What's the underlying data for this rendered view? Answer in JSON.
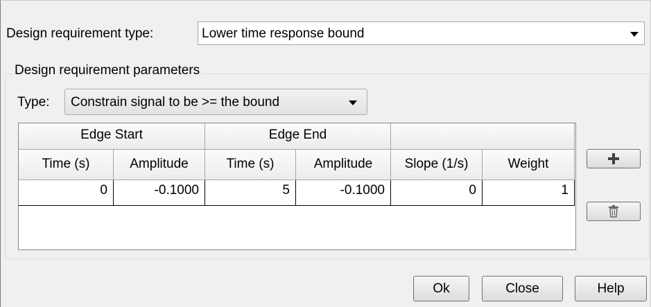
{
  "requirement": {
    "label": "Design requirement type:",
    "value": "Lower time response bound"
  },
  "parameters": {
    "group_title": "Design requirement parameters",
    "type_label": "Type:",
    "type_value": "Constrain signal to be >= the bound"
  },
  "table": {
    "group_headers": [
      "Edge Start",
      "Edge End",
      ""
    ],
    "columns": [
      "Time (s)",
      "Amplitude",
      "Time (s)",
      "Amplitude",
      "Slope (1/s)",
      "Weight"
    ],
    "rows": [
      [
        "0",
        "-0.1000",
        "5",
        "-0.1000",
        "0",
        "1"
      ]
    ]
  },
  "side_buttons": {
    "add_icon": "plus-icon",
    "delete_icon": "trash-icon"
  },
  "buttons": {
    "ok": "Ok",
    "close": "Close",
    "help": "Help"
  }
}
